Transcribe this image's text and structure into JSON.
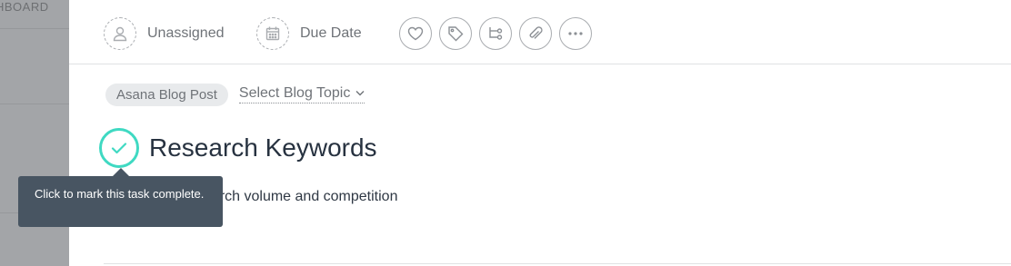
{
  "background": {
    "nav_label": "HBOARD"
  },
  "toolbar": {
    "assignee_label": "Unassigned",
    "due_date_label": "Due Date",
    "icons": [
      "heart-icon",
      "tag-icon",
      "subtask-icon",
      "attachment-icon",
      "more-icon"
    ]
  },
  "task": {
    "project_pill": "Asana Blog Post",
    "custom_field_label": "Select Blog Topic",
    "title": "Research Keywords",
    "description": "keyword search volume and competition"
  },
  "tooltip": {
    "text": "Click to mark this task complete."
  },
  "colors": {
    "check_accent": "#3fd9c2",
    "tooltip_bg": "#485562",
    "title_text": "#273240"
  }
}
